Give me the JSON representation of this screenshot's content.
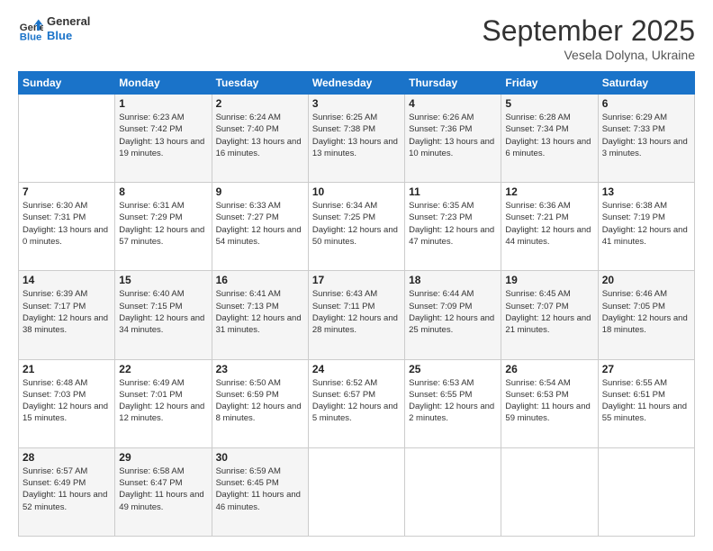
{
  "header": {
    "logo_line1": "General",
    "logo_line2": "Blue",
    "month_title": "September 2025",
    "subtitle": "Vesela Dolyna, Ukraine"
  },
  "weekdays": [
    "Sunday",
    "Monday",
    "Tuesday",
    "Wednesday",
    "Thursday",
    "Friday",
    "Saturday"
  ],
  "weeks": [
    [
      {
        "day": "",
        "sunrise": "",
        "sunset": "",
        "daylight": ""
      },
      {
        "day": "1",
        "sunrise": "Sunrise: 6:23 AM",
        "sunset": "Sunset: 7:42 PM",
        "daylight": "Daylight: 13 hours and 19 minutes."
      },
      {
        "day": "2",
        "sunrise": "Sunrise: 6:24 AM",
        "sunset": "Sunset: 7:40 PM",
        "daylight": "Daylight: 13 hours and 16 minutes."
      },
      {
        "day": "3",
        "sunrise": "Sunrise: 6:25 AM",
        "sunset": "Sunset: 7:38 PM",
        "daylight": "Daylight: 13 hours and 13 minutes."
      },
      {
        "day": "4",
        "sunrise": "Sunrise: 6:26 AM",
        "sunset": "Sunset: 7:36 PM",
        "daylight": "Daylight: 13 hours and 10 minutes."
      },
      {
        "day": "5",
        "sunrise": "Sunrise: 6:28 AM",
        "sunset": "Sunset: 7:34 PM",
        "daylight": "Daylight: 13 hours and 6 minutes."
      },
      {
        "day": "6",
        "sunrise": "Sunrise: 6:29 AM",
        "sunset": "Sunset: 7:33 PM",
        "daylight": "Daylight: 13 hours and 3 minutes."
      }
    ],
    [
      {
        "day": "7",
        "sunrise": "Sunrise: 6:30 AM",
        "sunset": "Sunset: 7:31 PM",
        "daylight": "Daylight: 13 hours and 0 minutes."
      },
      {
        "day": "8",
        "sunrise": "Sunrise: 6:31 AM",
        "sunset": "Sunset: 7:29 PM",
        "daylight": "Daylight: 12 hours and 57 minutes."
      },
      {
        "day": "9",
        "sunrise": "Sunrise: 6:33 AM",
        "sunset": "Sunset: 7:27 PM",
        "daylight": "Daylight: 12 hours and 54 minutes."
      },
      {
        "day": "10",
        "sunrise": "Sunrise: 6:34 AM",
        "sunset": "Sunset: 7:25 PM",
        "daylight": "Daylight: 12 hours and 50 minutes."
      },
      {
        "day": "11",
        "sunrise": "Sunrise: 6:35 AM",
        "sunset": "Sunset: 7:23 PM",
        "daylight": "Daylight: 12 hours and 47 minutes."
      },
      {
        "day": "12",
        "sunrise": "Sunrise: 6:36 AM",
        "sunset": "Sunset: 7:21 PM",
        "daylight": "Daylight: 12 hours and 44 minutes."
      },
      {
        "day": "13",
        "sunrise": "Sunrise: 6:38 AM",
        "sunset": "Sunset: 7:19 PM",
        "daylight": "Daylight: 12 hours and 41 minutes."
      }
    ],
    [
      {
        "day": "14",
        "sunrise": "Sunrise: 6:39 AM",
        "sunset": "Sunset: 7:17 PM",
        "daylight": "Daylight: 12 hours and 38 minutes."
      },
      {
        "day": "15",
        "sunrise": "Sunrise: 6:40 AM",
        "sunset": "Sunset: 7:15 PM",
        "daylight": "Daylight: 12 hours and 34 minutes."
      },
      {
        "day": "16",
        "sunrise": "Sunrise: 6:41 AM",
        "sunset": "Sunset: 7:13 PM",
        "daylight": "Daylight: 12 hours and 31 minutes."
      },
      {
        "day": "17",
        "sunrise": "Sunrise: 6:43 AM",
        "sunset": "Sunset: 7:11 PM",
        "daylight": "Daylight: 12 hours and 28 minutes."
      },
      {
        "day": "18",
        "sunrise": "Sunrise: 6:44 AM",
        "sunset": "Sunset: 7:09 PM",
        "daylight": "Daylight: 12 hours and 25 minutes."
      },
      {
        "day": "19",
        "sunrise": "Sunrise: 6:45 AM",
        "sunset": "Sunset: 7:07 PM",
        "daylight": "Daylight: 12 hours and 21 minutes."
      },
      {
        "day": "20",
        "sunrise": "Sunrise: 6:46 AM",
        "sunset": "Sunset: 7:05 PM",
        "daylight": "Daylight: 12 hours and 18 minutes."
      }
    ],
    [
      {
        "day": "21",
        "sunrise": "Sunrise: 6:48 AM",
        "sunset": "Sunset: 7:03 PM",
        "daylight": "Daylight: 12 hours and 15 minutes."
      },
      {
        "day": "22",
        "sunrise": "Sunrise: 6:49 AM",
        "sunset": "Sunset: 7:01 PM",
        "daylight": "Daylight: 12 hours and 12 minutes."
      },
      {
        "day": "23",
        "sunrise": "Sunrise: 6:50 AM",
        "sunset": "Sunset: 6:59 PM",
        "daylight": "Daylight: 12 hours and 8 minutes."
      },
      {
        "day": "24",
        "sunrise": "Sunrise: 6:52 AM",
        "sunset": "Sunset: 6:57 PM",
        "daylight": "Daylight: 12 hours and 5 minutes."
      },
      {
        "day": "25",
        "sunrise": "Sunrise: 6:53 AM",
        "sunset": "Sunset: 6:55 PM",
        "daylight": "Daylight: 12 hours and 2 minutes."
      },
      {
        "day": "26",
        "sunrise": "Sunrise: 6:54 AM",
        "sunset": "Sunset: 6:53 PM",
        "daylight": "Daylight: 11 hours and 59 minutes."
      },
      {
        "day": "27",
        "sunrise": "Sunrise: 6:55 AM",
        "sunset": "Sunset: 6:51 PM",
        "daylight": "Daylight: 11 hours and 55 minutes."
      }
    ],
    [
      {
        "day": "28",
        "sunrise": "Sunrise: 6:57 AM",
        "sunset": "Sunset: 6:49 PM",
        "daylight": "Daylight: 11 hours and 52 minutes."
      },
      {
        "day": "29",
        "sunrise": "Sunrise: 6:58 AM",
        "sunset": "Sunset: 6:47 PM",
        "daylight": "Daylight: 11 hours and 49 minutes."
      },
      {
        "day": "30",
        "sunrise": "Sunrise: 6:59 AM",
        "sunset": "Sunset: 6:45 PM",
        "daylight": "Daylight: 11 hours and 46 minutes."
      },
      {
        "day": "",
        "sunrise": "",
        "sunset": "",
        "daylight": ""
      },
      {
        "day": "",
        "sunrise": "",
        "sunset": "",
        "daylight": ""
      },
      {
        "day": "",
        "sunrise": "",
        "sunset": "",
        "daylight": ""
      },
      {
        "day": "",
        "sunrise": "",
        "sunset": "",
        "daylight": ""
      }
    ]
  ]
}
